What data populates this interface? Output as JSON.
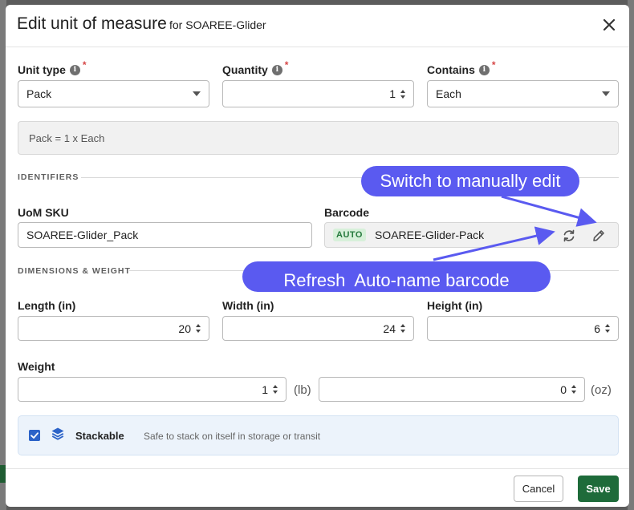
{
  "modal": {
    "title": "Edit unit of measure",
    "subtitle": "for SOAREE-Glider"
  },
  "unit_type": {
    "label": "Unit type",
    "value": "Pack",
    "required_mark": "*"
  },
  "quantity": {
    "label": "Quantity",
    "value": "1",
    "required_mark": "*"
  },
  "contains": {
    "label": "Contains",
    "value": "Each",
    "required_mark": "*"
  },
  "summary_text": "Pack = 1 x Each",
  "identifiers": {
    "section_title": "IDENTIFIERS",
    "uom_sku_label": "UoM SKU",
    "uom_sku_value": "SOAREE-Glider_Pack",
    "barcode_label": "Barcode",
    "barcode_badge": "AUTO",
    "barcode_value": "SOAREE-Glider-Pack"
  },
  "dimensions": {
    "section_title": "DIMENSIONS & WEIGHT",
    "length_label": "Length (in)",
    "length_value": "20",
    "width_label": "Width (in)",
    "width_value": "24",
    "height_label": "Height (in)",
    "height_value": "6",
    "weight_label": "Weight",
    "weight_lb_value": "1",
    "weight_lb_unit": "(lb)",
    "weight_oz_value": "0",
    "weight_oz_unit": "(oz)"
  },
  "stackable": {
    "checked": true,
    "title": "Stackable",
    "description": "Safe to stack on itself in storage or transit"
  },
  "footer": {
    "cancel_label": "Cancel",
    "save_label": "Save"
  },
  "annotations": {
    "switch_edit": "Switch to manually edit",
    "refresh": "Refresh  Auto-name barcode"
  },
  "colors": {
    "accent_blue": "#2c63c8",
    "save_green": "#1e6b3a",
    "callout": "#5a5af0",
    "auto_badge_bg": "#d7f0da"
  },
  "icons": [
    "info-icon",
    "close-icon",
    "chevron-down-icon",
    "spinner-icon",
    "refresh-icon",
    "pencil-icon",
    "checkbox-icon",
    "layers-icon"
  ]
}
